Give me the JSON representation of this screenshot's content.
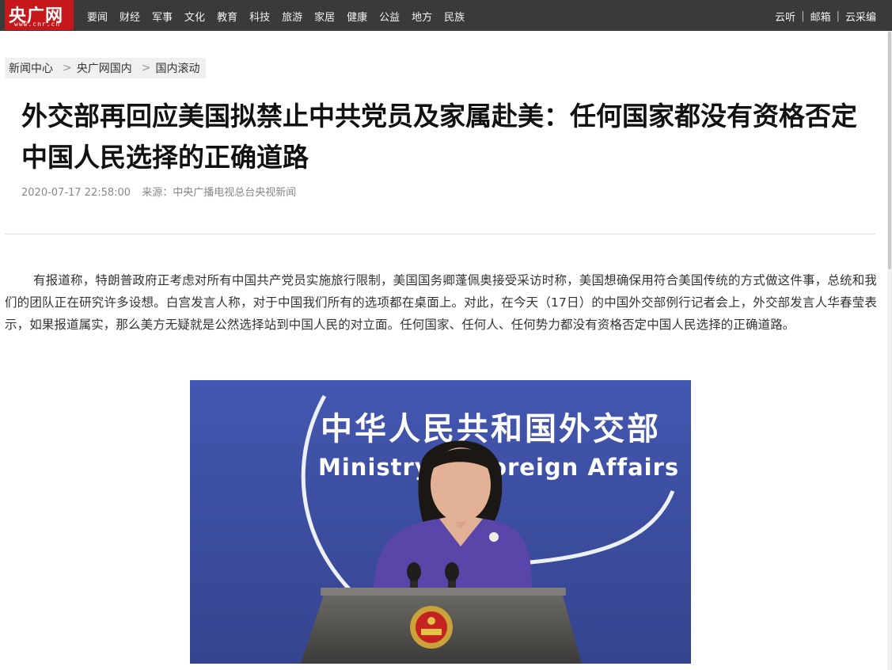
{
  "topbar": {
    "logo_text": "央广网",
    "logo_domain": "www.cnr.cn",
    "nav_items": [
      "要闻",
      "财经",
      "军事",
      "文化",
      "教育",
      "科技",
      "旅游",
      "家居",
      "健康",
      "公益",
      "地方",
      "民族"
    ],
    "right_links": [
      "云听",
      "邮箱",
      "云采编"
    ],
    "separator": "|"
  },
  "breadcrumb": {
    "items": [
      "新闻中心",
      "央广网国内",
      "国内滚动"
    ],
    "separator": ">"
  },
  "article": {
    "title": "外交部再回应美国拟禁止中共党员及家属赴美：任何国家都没有资格否定中国人民选择的正确道路",
    "datetime": "2020-07-17 22:58:00",
    "source": "来源：中央广播电视总台央视新闻",
    "paragraph": "有报道称，特朗普政府正考虑对所有中国共产党员实施旅行限制，美国国务卿蓬佩奥接受采访时称，美国想确保用符合美国传统的方式做这件事，总统和我们的团队正在研究许多设想。白宫发言人称，对于中国我们所有的选项都在桌面上。对此，在今天（17日）的中国外交部例行记者会上，外交部发言人华春莹表示，如果报道属实，那么美方无疑就是公然选择站到中国人民的对立面。任何国家、任何人、任何势力都没有资格否定中国人民选择的正确道路。"
  },
  "photo": {
    "backdrop_zh": "中华人民共和国外交部",
    "backdrop_en": "Ministry of Foreign Affairs"
  },
  "colors": {
    "topbar_bg": "#3a3a3a",
    "logo_red": "#c6171a",
    "backdrop_blue": "#3d4ea6"
  }
}
